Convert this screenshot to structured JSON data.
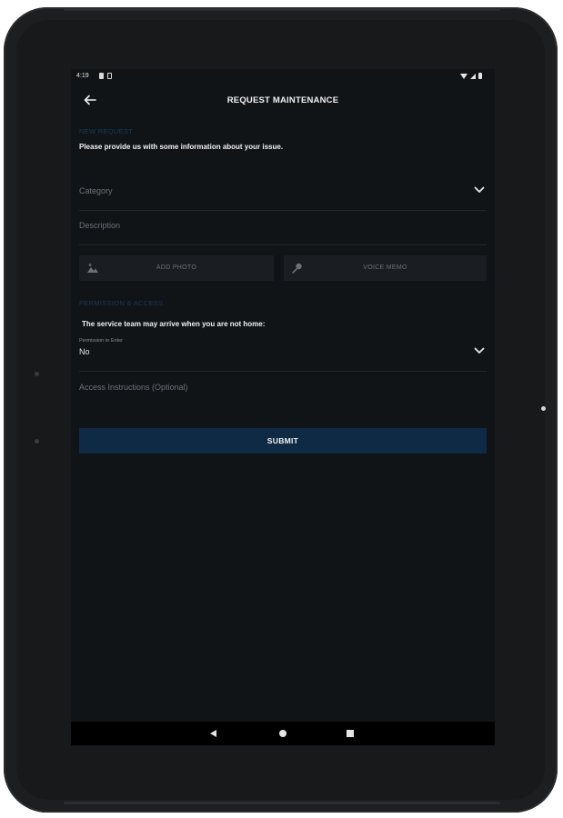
{
  "status_bar": {
    "time": "4:19"
  },
  "app_bar": {
    "title": "REQUEST MAINTENANCE"
  },
  "section_issue": {
    "label": "NEW REQUEST",
    "intro": "Please provide us with some information about your issue."
  },
  "fields": {
    "category_placeholder": "Category",
    "description_placeholder": "Description"
  },
  "media": {
    "add_photo_label": "ADD PHOTO",
    "voice_memo_label": "VOICE MEMO"
  },
  "section_permission": {
    "label": "PERMISSION & ACCESS",
    "absent_text": "The service team may arrive when you are not home:"
  },
  "permission_field": {
    "label": "Permission to Enter",
    "value": "No"
  },
  "access_field": {
    "placeholder": "Access Instructions (Optional)"
  },
  "submit": {
    "label": "SUBMIT"
  },
  "colors": {
    "screen_bg": "#111417",
    "accent_button": "#0f2a45",
    "section_label": "#173a5a",
    "text_primary": "#f2f2f2",
    "text_muted": "#6d7278"
  },
  "icons": [
    "back-arrow-icon",
    "chevron-down-icon",
    "image-icon",
    "microphone-icon",
    "wifi-icon",
    "signal-icon",
    "battery-icon",
    "nav-back-icon",
    "nav-home-icon",
    "nav-recent-icon"
  ]
}
